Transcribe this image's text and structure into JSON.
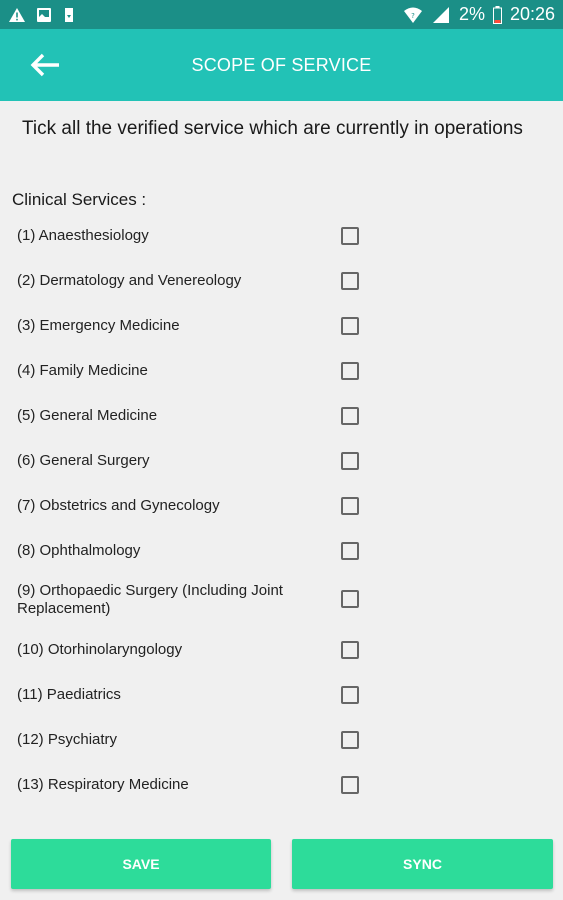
{
  "status_bar": {
    "battery": "2%",
    "time": "20:26",
    "icons": [
      "warning-icon",
      "image-icon",
      "download-icon",
      "wifi-icon",
      "signal-icon",
      "battery-icon"
    ]
  },
  "app_bar": {
    "title": "SCOPE OF SERVICE",
    "back_icon": "arrow-left-icon",
    "color": "#22c2b6"
  },
  "instruction": "Tick all the verified service which are currently in operations",
  "section_label": "Clinical Services :",
  "services": [
    {
      "label": "(1) Anaesthesiology",
      "checked": false
    },
    {
      "label": "(2) Dermatology and Venereology",
      "checked": false
    },
    {
      "label": "(3) Emergency Medicine",
      "checked": false
    },
    {
      "label": "(4) Family Medicine",
      "checked": false
    },
    {
      "label": "(5) General Medicine",
      "checked": false
    },
    {
      "label": "(6) General Surgery",
      "checked": false
    },
    {
      "label": "(7) Obstetrics and Gynecology",
      "checked": false
    },
    {
      "label": "(8) Ophthalmology",
      "checked": false
    },
    {
      "label": "(9) Orthopaedic Surgery (Including Joint Replacement)",
      "checked": false
    },
    {
      "label": "(10) Otorhinolaryngology",
      "checked": false
    },
    {
      "label": "(11) Paediatrics",
      "checked": false
    },
    {
      "label": "(12) Psychiatry",
      "checked": false
    },
    {
      "label": "(13) Respiratory Medicine",
      "checked": false
    }
  ],
  "buttons": {
    "save": "SAVE",
    "sync": "SYNC",
    "color": "#2ddc9a"
  }
}
